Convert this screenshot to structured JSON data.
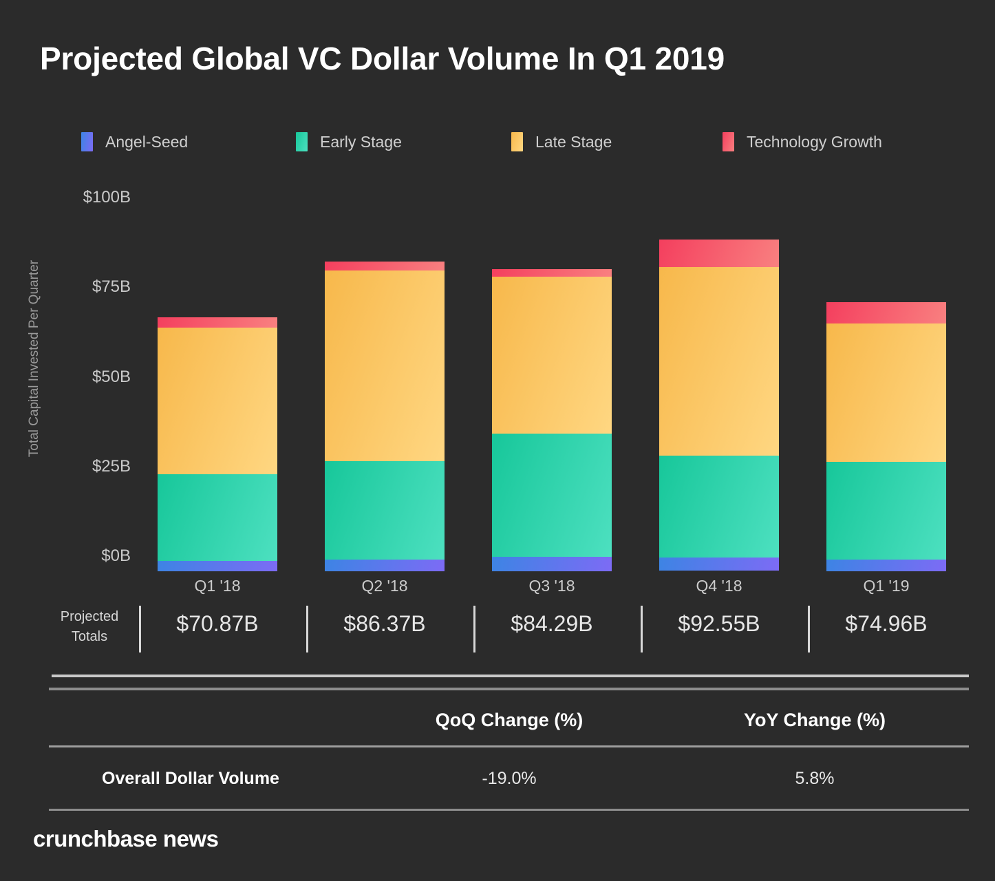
{
  "title": "Projected Global VC Dollar Volume In Q1 2019",
  "footer": {
    "logo": "crunchbase news"
  },
  "totals_row": {
    "label_line1": "Projected",
    "label_line2": "Totals"
  },
  "table": {
    "col_headers": [
      "QoQ Change (%)",
      "YoY Change (%)"
    ],
    "rows": [
      {
        "label": "Overall Dollar Volume",
        "qoq": "-19.0%",
        "yoy": "5.8%"
      }
    ]
  },
  "colors": {
    "background": "#2b2b2b",
    "angel_seed": "#5b76ee",
    "early_stage": "#28d2ab",
    "late_stage": "#f9c45c",
    "technology_growth": "#f5576c",
    "text_primary": "#ffffff",
    "text_muted": "#c9c9c9"
  },
  "chart_data": {
    "type": "bar",
    "stacked": true,
    "title": "Projected Global VC Dollar Volume In Q1 2019",
    "xlabel": "",
    "ylabel": "Total Capital Invested Per Quarter",
    "ylim": [
      0,
      100
    ],
    "yticks": [
      0,
      25,
      50,
      75,
      100
    ],
    "ytick_labels": [
      "$0B",
      "$25B",
      "$50B",
      "$75B",
      "$100B"
    ],
    "unit": "billions of USD",
    "grid": false,
    "legend_position": "top",
    "categories": [
      "Q1 '18",
      "Q2 '18",
      "Q3 '18",
      "Q4 '18",
      "Q1 '19"
    ],
    "series": [
      {
        "name": "Angel-Seed",
        "color": "#5b76ee",
        "values": [
          2.9,
          3.2,
          4.0,
          3.6,
          3.3
        ]
      },
      {
        "name": "Early Stage",
        "color": "#28d2ab",
        "values": [
          24.2,
          27.6,
          34.4,
          28.4,
          27.3
        ]
      },
      {
        "name": "Late Stage",
        "color": "#f9c45c",
        "values": [
          41.1,
          53.4,
          44.0,
          52.6,
          38.8
        ]
      },
      {
        "name": "Technology Growth",
        "color": "#f5576c",
        "values": [
          2.9,
          2.5,
          2.1,
          7.7,
          5.8
        ]
      }
    ],
    "totals": [
      70.87,
      86.37,
      84.29,
      92.55,
      74.96
    ],
    "total_labels": [
      "$70.87B",
      "$86.37B",
      "$84.29B",
      "$92.55B",
      "$74.96B"
    ],
    "annotations": {
      "qoq_change_pct": -19.0,
      "yoy_change_pct": 5.8
    }
  }
}
